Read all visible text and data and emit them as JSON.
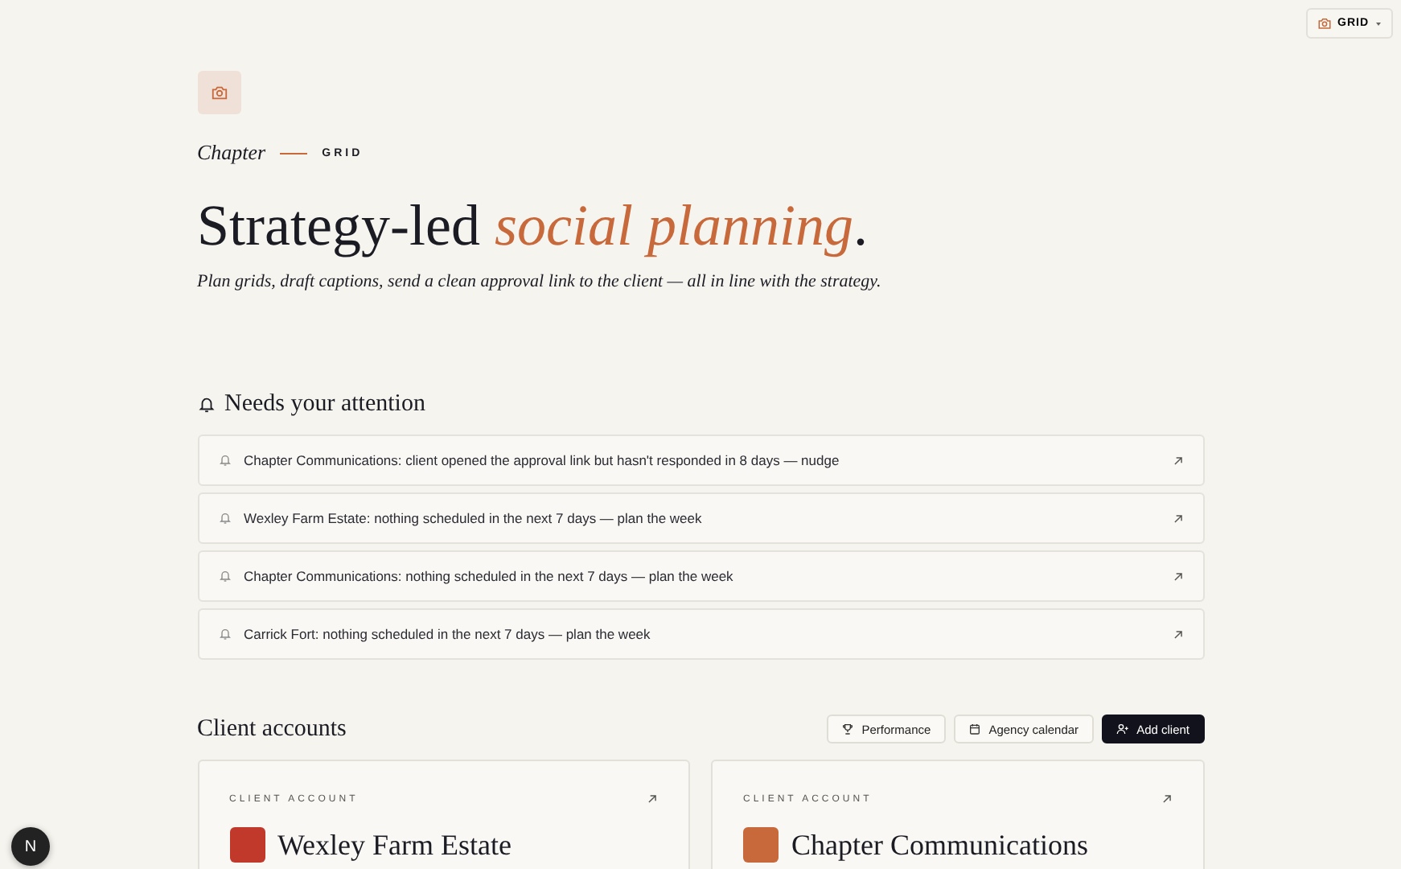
{
  "top_switch": {
    "label": "GRID"
  },
  "hero": {
    "brand": "Chapter",
    "tag": "GRID",
    "title": "Strategy-led *social planning*.",
    "subtitle": "Plan grids, draft captions, send a clean approval link to the client — all in line with the strategy."
  },
  "attention": {
    "title": "Needs your attention",
    "items": [
      {
        "text": "Chapter Communications: client opened the approval link but hasn't responded in 8 days — nudge"
      },
      {
        "text": "Wexley Farm Estate: nothing scheduled in the next 7 days — plan the week"
      },
      {
        "text": "Chapter Communications: nothing scheduled in the next 7 days — plan the week"
      },
      {
        "text": "Carrick Fort: nothing scheduled in the next 7 days — plan the week"
      }
    ]
  },
  "clients": {
    "title": "Client accounts",
    "actions": [
      {
        "label": "Performance",
        "kind": "trophy"
      },
      {
        "label": "Agency calendar",
        "kind": "calendar"
      },
      {
        "label": "Add client",
        "kind": "add"
      }
    ],
    "cards": [
      {
        "label": "CLIENT ACCOUNT",
        "name": "Wexley Farm Estate",
        "color": "#c0392b"
      },
      {
        "label": "CLIENT ACCOUNT",
        "name": "Chapter Communications",
        "color": "#c8693b"
      }
    ]
  },
  "dev_badge": {
    "label": "N"
  }
}
